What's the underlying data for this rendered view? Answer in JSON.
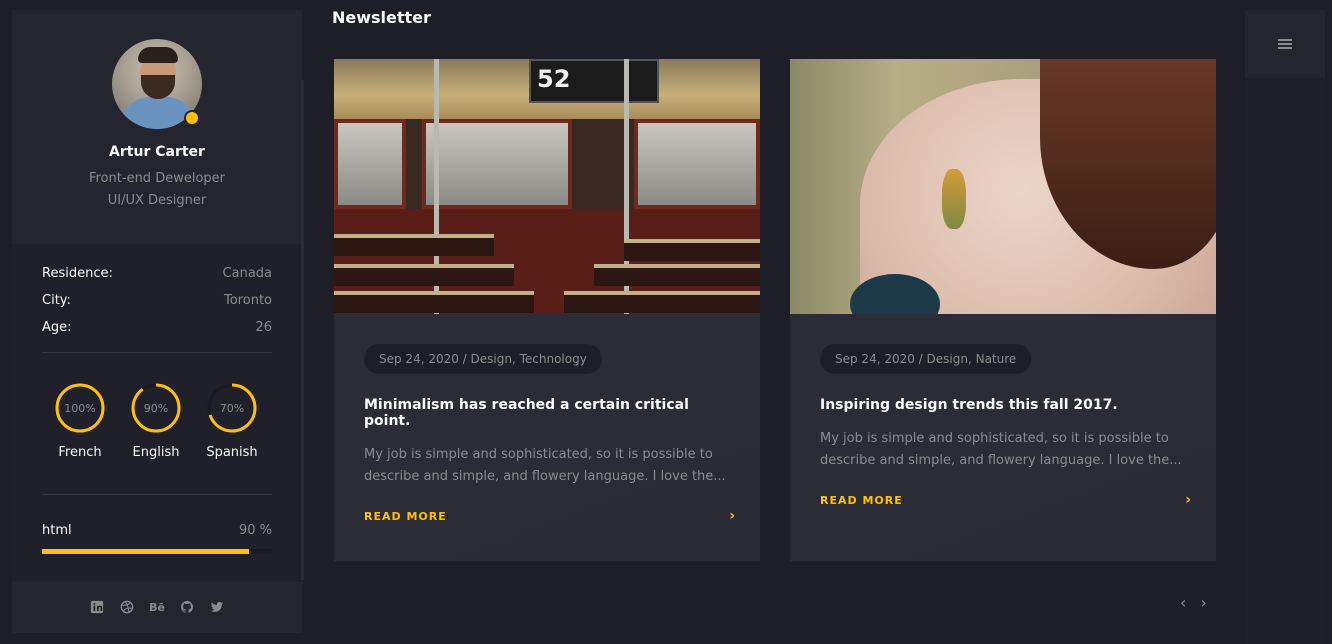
{
  "profile": {
    "name": "Artur Carter",
    "roles": [
      "Front-end Deweloper",
      "UI/UX Designer"
    ]
  },
  "info": [
    {
      "key": "Residence:",
      "value": "Canada"
    },
    {
      "key": "City:",
      "value": "Toronto"
    },
    {
      "key": "Age:",
      "value": "26"
    }
  ],
  "languages": [
    {
      "name": "French",
      "percent_label": "100%",
      "percent": 100
    },
    {
      "name": "English",
      "percent_label": "90%",
      "percent": 90
    },
    {
      "name": "Spanish",
      "percent_label": "70%",
      "percent": 70
    }
  ],
  "skills": [
    {
      "name": "html",
      "value_label": "90 %",
      "percent": 90
    }
  ],
  "socials": [
    {
      "icon": "linkedin-icon"
    },
    {
      "icon": "dribbble-icon"
    },
    {
      "icon": "behance-icon",
      "label": "Bē"
    },
    {
      "icon": "github-icon"
    },
    {
      "icon": "twitter-icon"
    }
  ],
  "page": {
    "title": "Newsletter"
  },
  "posts": [
    {
      "meta": "Sep 24, 2020 / Design, Technology",
      "title": "Minimalism has reached a certain critical point.",
      "excerpt": "My job is simple and sophisticated, so it is possible to describe and simple, and flowery language. I love the...",
      "read_more": "READ MORE",
      "image": "bus-interior"
    },
    {
      "meta": "Sep 24, 2020 / Design, Nature",
      "title": "Inspiring design trends this fall 2017.",
      "excerpt": "My job is simple and sophisticated, so it is possible to describe and simple, and flowery language. I love the...",
      "read_more": "READ MORE",
      "image": "woman-with-flower"
    }
  ],
  "bus_sign": "52",
  "colors": {
    "accent": "#ffc107",
    "background": "#1e1e28",
    "card": "#2b2b35",
    "muted_text": "#8c8c8e"
  }
}
